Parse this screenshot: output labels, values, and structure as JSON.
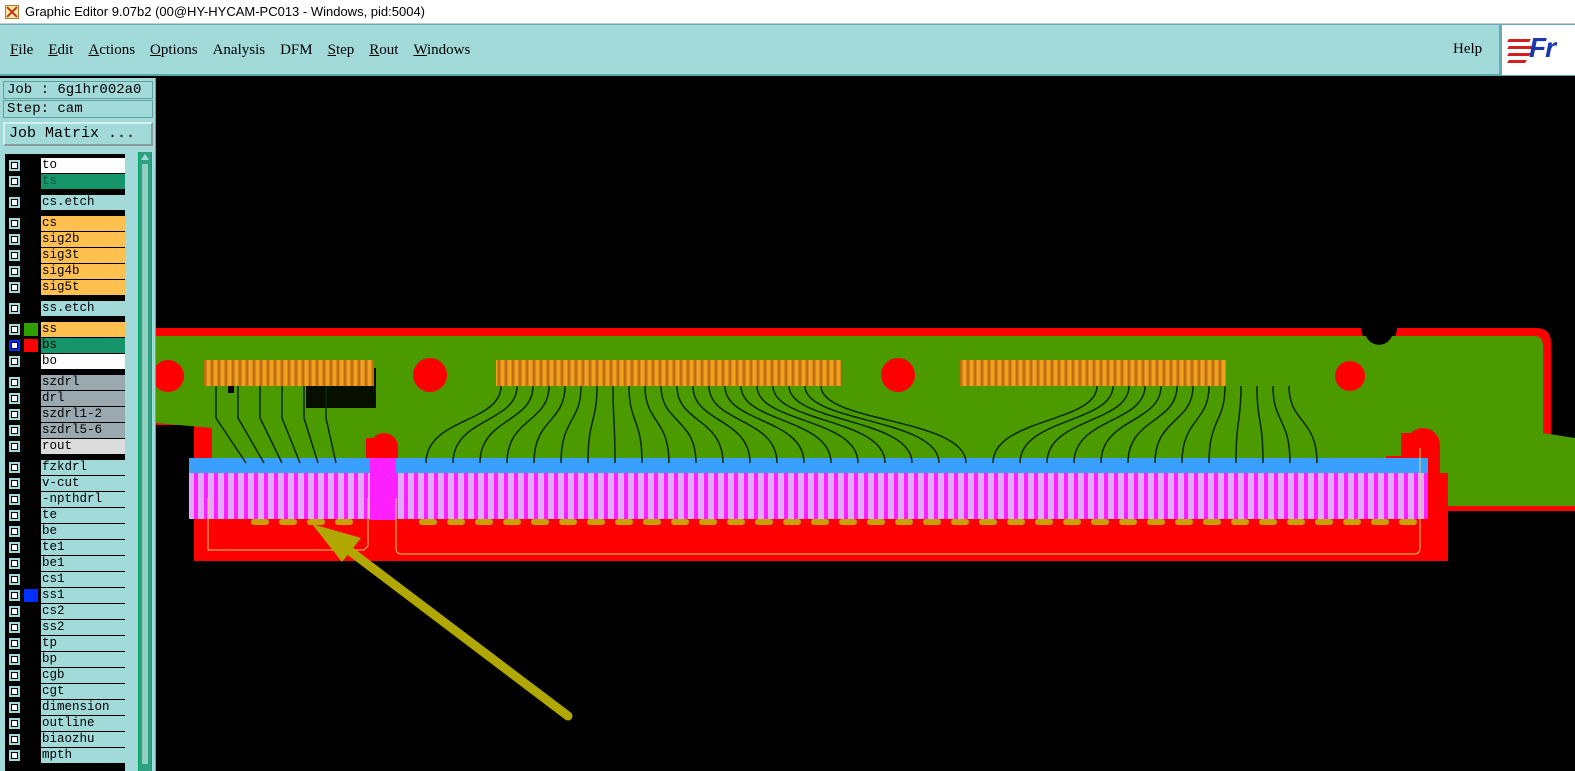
{
  "window": {
    "title": "Graphic Editor 9.07b2 (00@HY-HYCAM-PC013 - Windows, pid:5004)"
  },
  "menu": {
    "items": [
      {
        "id": "file",
        "label": "File",
        "ul": "F"
      },
      {
        "id": "edit",
        "label": "Edit",
        "ul": "E"
      },
      {
        "id": "actions",
        "label": "Actions",
        "ul": "A"
      },
      {
        "id": "options",
        "label": "Options",
        "ul": "O"
      },
      {
        "id": "analysis",
        "label": "Analysis",
        "ul": ""
      },
      {
        "id": "dfm",
        "label": "DFM",
        "ul": ""
      },
      {
        "id": "step",
        "label": "Step",
        "ul": "S"
      },
      {
        "id": "rout",
        "label": "Rout",
        "ul": "R"
      },
      {
        "id": "windows",
        "label": "Windows",
        "ul": "W"
      }
    ],
    "help": "Help"
  },
  "logo": {
    "text": "Fr"
  },
  "job": {
    "label": "Job : 6g1hr002a0",
    "step": "Step: cam",
    "matrix_button": "Job Matrix ..."
  },
  "colors": {
    "panel": "#a2dada",
    "orange": "#ffc050",
    "green": "#16946a",
    "gray": "#9aa8b0",
    "light": "#a2dada",
    "white": "#ffffff",
    "board": "#4a9a00",
    "mask_red": "#ff0000",
    "blue": "#3aa0ff",
    "magenta": "#ff20ff",
    "arrow": "#b0a800"
  },
  "layers": [
    {
      "name": "to",
      "bg": "white",
      "sw": "#000000"
    },
    {
      "name": "ts",
      "bg": "green",
      "sw": "#000000"
    },
    {
      "name": "cs.etch",
      "bg": "light",
      "sw": "#000000",
      "gap": true
    },
    {
      "name": "cs",
      "bg": "orange",
      "sw": "#000000",
      "gap": true
    },
    {
      "name": "sig2b",
      "bg": "orange",
      "sw": "#000000"
    },
    {
      "name": "sig3t",
      "bg": "orange",
      "sw": "#000000"
    },
    {
      "name": "sig4b",
      "bg": "orange",
      "sw": "#000000"
    },
    {
      "name": "sig5t",
      "bg": "orange",
      "sw": "#000000"
    },
    {
      "name": "ss.etch",
      "bg": "light",
      "sw": "#000000",
      "gap": true
    },
    {
      "name": "ss",
      "bg": "orange",
      "sw": "#2ea000",
      "gap": true
    },
    {
      "name": "bs",
      "bg": "green",
      "sw": "#ff0000",
      "selected": true
    },
    {
      "name": "bo",
      "bg": "white",
      "sw": "#000000"
    },
    {
      "name": "szdrl",
      "bg": "gray",
      "sw": "#000000",
      "gap": true
    },
    {
      "name": "drl",
      "bg": "gray",
      "sw": "#000000"
    },
    {
      "name": "szdrl1-2",
      "bg": "gray",
      "sw": "#000000"
    },
    {
      "name": "szdrl5-6",
      "bg": "gray",
      "sw": "#000000"
    },
    {
      "name": "rout",
      "bg": "#dcdcdc",
      "sw": "#000000"
    },
    {
      "name": "fzkdrl",
      "bg": "light",
      "sw": "#000000",
      "gap": true
    },
    {
      "name": "v-cut",
      "bg": "light",
      "sw": "#000000"
    },
    {
      "name": "-npthdrl",
      "bg": "light",
      "sw": "#000000"
    },
    {
      "name": "te",
      "bg": "light",
      "sw": "#000000"
    },
    {
      "name": "be",
      "bg": "light",
      "sw": "#000000"
    },
    {
      "name": "te1",
      "bg": "light",
      "sw": "#000000"
    },
    {
      "name": "be1",
      "bg": "light",
      "sw": "#000000"
    },
    {
      "name": "cs1",
      "bg": "light",
      "sw": "#000000"
    },
    {
      "name": "ss1",
      "bg": "light",
      "sw": "#0030ff"
    },
    {
      "name": "cs2",
      "bg": "light",
      "sw": "#000000"
    },
    {
      "name": "ss2",
      "bg": "light",
      "sw": "#000000"
    },
    {
      "name": "tp",
      "bg": "light",
      "sw": "#000000"
    },
    {
      "name": "bp",
      "bg": "light",
      "sw": "#000000"
    },
    {
      "name": "cgb",
      "bg": "light",
      "sw": "#000000"
    },
    {
      "name": "cgt",
      "bg": "light",
      "sw": "#000000"
    },
    {
      "name": "dimension",
      "bg": "light",
      "sw": "#000000"
    },
    {
      "name": "outline",
      "bg": "light",
      "sw": "#000000"
    },
    {
      "name": "biaozhu",
      "bg": "light",
      "sw": "#000000"
    },
    {
      "name": "mpth",
      "bg": "light",
      "sw": "#000000"
    }
  ]
}
